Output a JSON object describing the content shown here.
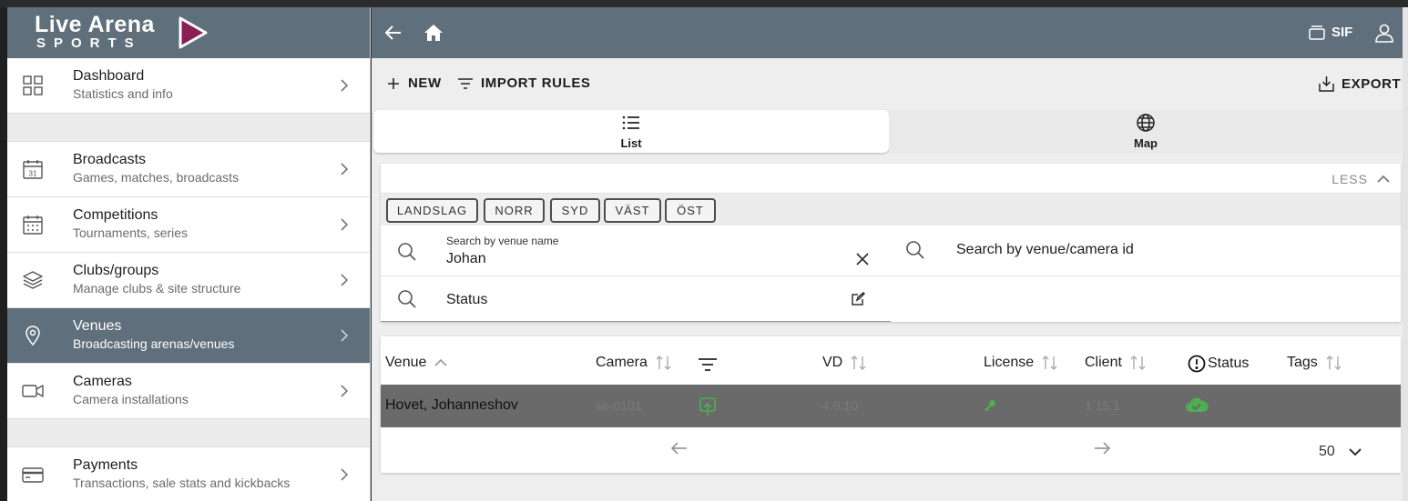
{
  "brand": {
    "line1": "Live Arena",
    "line2": "SPORTS",
    "accent_color": "#8a1f55"
  },
  "colors": {
    "header_bg": "#5f6f7b",
    "status_green": "#4caf50",
    "row_highlight": "#6a6a6a"
  },
  "sidebar": {
    "items": [
      {
        "title": "Dashboard",
        "subtitle": "Statistics and info",
        "icon": "dashboard-grid-icon"
      },
      {
        "title": "Broadcasts",
        "subtitle": "Games, matches, broadcasts",
        "icon": "calendar-31-icon"
      },
      {
        "title": "Competitions",
        "subtitle": "Tournaments, series",
        "icon": "calendar-grid-icon"
      },
      {
        "title": "Clubs/groups",
        "subtitle": "Manage clubs & site structure",
        "icon": "layers-icon"
      },
      {
        "title": "Venues",
        "subtitle": "Broadcasting arenas/venues",
        "icon": "location-pin-icon",
        "active": true
      },
      {
        "title": "Cameras",
        "subtitle": "Camera installations",
        "icon": "video-camera-icon"
      },
      {
        "title": "Payments",
        "subtitle": "Transactions, sale stats and kickbacks",
        "icon": "credit-card-icon"
      }
    ]
  },
  "header": {
    "org_label": "SIF"
  },
  "toolbar": {
    "new_label": "NEW",
    "import_label": "IMPORT RULES",
    "export_label": "EXPORT"
  },
  "tabs": [
    {
      "label": "List",
      "active": true
    },
    {
      "label": "Map",
      "active": false
    }
  ],
  "filters": {
    "less_label": "LESS",
    "chips": [
      "LANDSLAG",
      "NORR",
      "SYD",
      "VÄST",
      "ÖST"
    ],
    "venue_name": {
      "label": "Search by venue name",
      "value": "Johan"
    },
    "venue_id": {
      "placeholder": "Search by venue/camera id"
    },
    "status": {
      "placeholder": "Status"
    }
  },
  "table": {
    "columns": [
      "Venue",
      "Camera",
      "VD",
      "License",
      "Client",
      "Status",
      "Tags"
    ],
    "rows": [
      {
        "venue": "Hovet, Johanneshov",
        "camera": "se-0101",
        "vd": "4.0.10",
        "client": "1.15.1"
      }
    ],
    "per_page": "50"
  }
}
